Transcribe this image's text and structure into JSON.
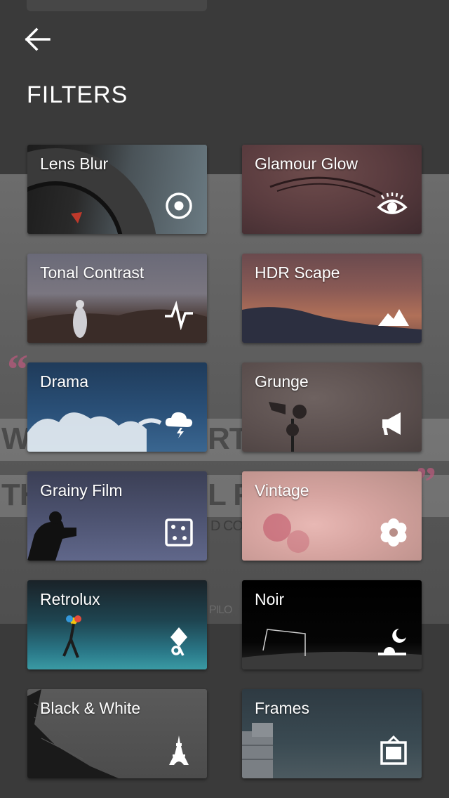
{
  "header": {
    "title": "FILTERS",
    "back_icon": "arrow-left-icon"
  },
  "background": {
    "left_text_1": "WH",
    "mid_text_1": "RT IS",
    "left_text_2": "TH",
    "mid_text_2": "L FIN",
    "small_text": "D CO",
    "credit_text": "PILO",
    "quote_left": "“",
    "quote_right": "”"
  },
  "filters": [
    {
      "label": "Lens Blur",
      "icon": "target-icon"
    },
    {
      "label": "Glamour Glow",
      "icon": "eye-icon"
    },
    {
      "label": "Tonal Contrast",
      "icon": "pulse-icon"
    },
    {
      "label": "HDR Scape",
      "icon": "mountains-icon"
    },
    {
      "label": "Drama",
      "icon": "storm-cloud-icon"
    },
    {
      "label": "Grunge",
      "icon": "megaphone-icon"
    },
    {
      "label": "Grainy Film",
      "icon": "dice-icon"
    },
    {
      "label": "Vintage",
      "icon": "flower-icon"
    },
    {
      "label": "Retrolux",
      "icon": "kite-icon"
    },
    {
      "label": "Noir",
      "icon": "moon-icon"
    },
    {
      "label": "Black & White",
      "icon": "eiffel-tower-icon"
    },
    {
      "label": "Frames",
      "icon": "frame-icon"
    }
  ]
}
